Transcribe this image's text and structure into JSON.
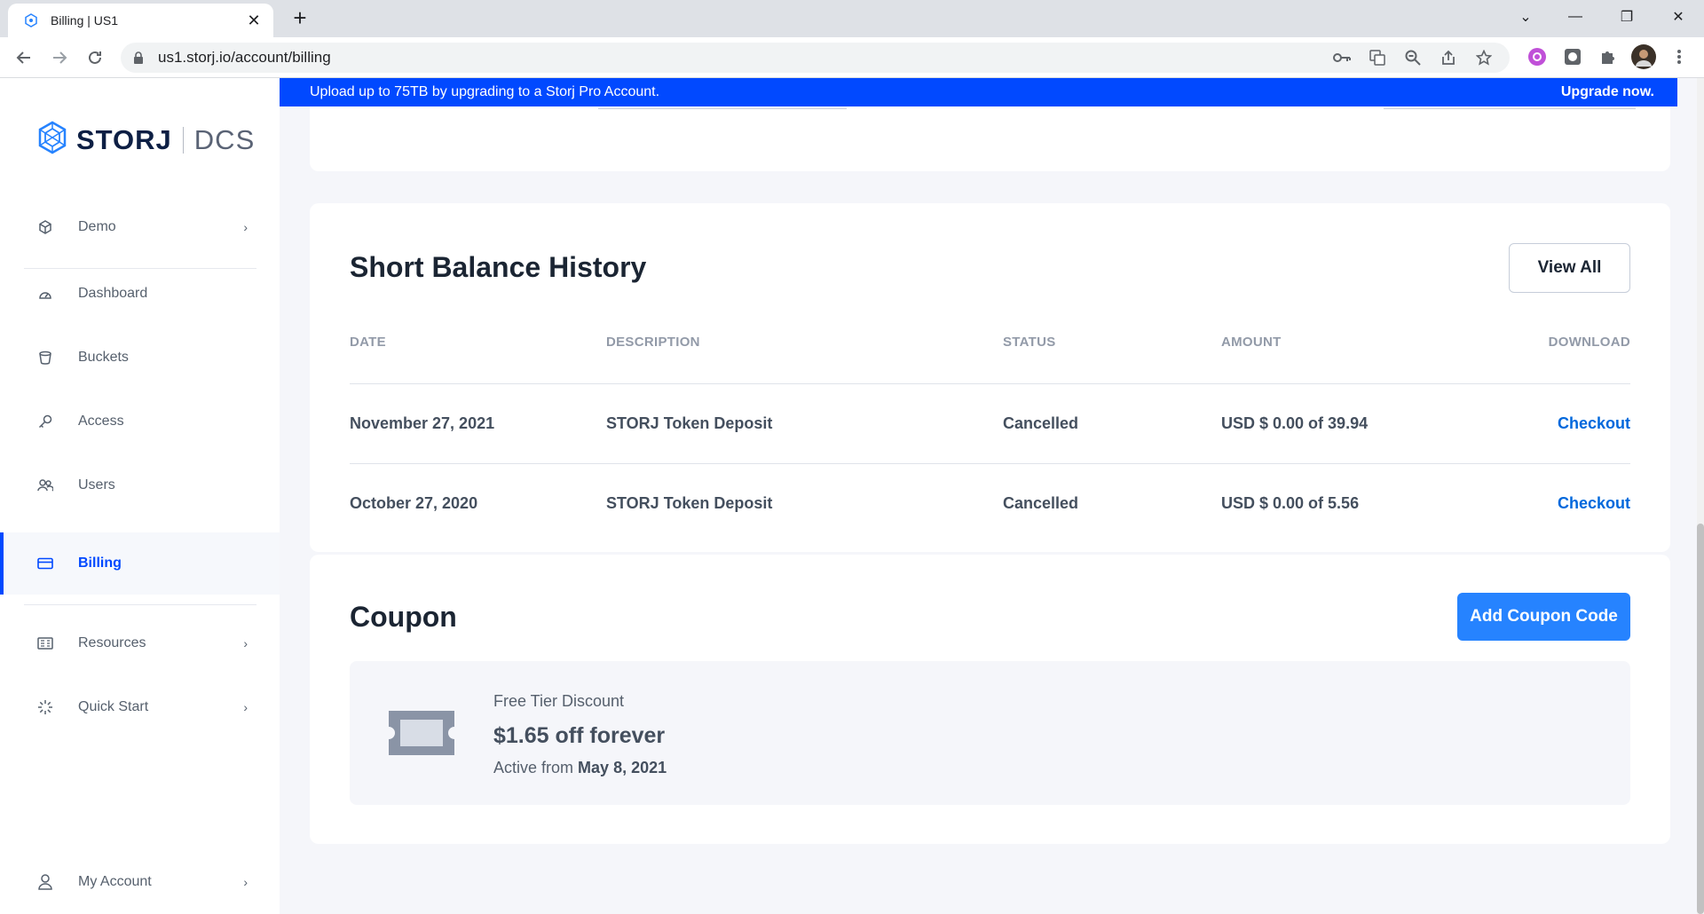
{
  "browser": {
    "tab_title": "Billing | US1",
    "new_tab": "+",
    "close_tab": "✕",
    "url": "us1.storj.io/account/billing",
    "window_controls": [
      "⌄",
      "—",
      "❐",
      "✕"
    ]
  },
  "banner": {
    "message": "Upload up to 75TB by upgrading to a Storj Pro Account.",
    "cta": "Upgrade now."
  },
  "sidebar": {
    "brand": "STORJ",
    "product": "DCS",
    "project": {
      "label": "Demo",
      "icon": "cube-icon"
    },
    "items": [
      {
        "label": "Dashboard",
        "icon": "dashboard-icon"
      },
      {
        "label": "Buckets",
        "icon": "bucket-icon"
      },
      {
        "label": "Access",
        "icon": "key-icon"
      },
      {
        "label": "Users",
        "icon": "users-icon"
      },
      {
        "label": "Billing",
        "icon": "card-icon",
        "active": true
      }
    ],
    "resources": {
      "label": "Resources",
      "icon": "resources-icon"
    },
    "quick_start": {
      "label": "Quick Start",
      "icon": "sparkle-icon"
    },
    "account": {
      "label": "My Account",
      "icon": "user-icon"
    }
  },
  "balance_history": {
    "title": "Short Balance History",
    "view_all": "View All",
    "columns": [
      "DATE",
      "DESCRIPTION",
      "STATUS",
      "AMOUNT",
      "DOWNLOAD"
    ],
    "rows": [
      {
        "date": "November 27, 2021",
        "description": "STORJ Token Deposit",
        "status": "Cancelled",
        "amount": "USD $ 0.00 of 39.94",
        "download": "Checkout"
      },
      {
        "date": "October 27, 2020",
        "description": "STORJ Token Deposit",
        "status": "Cancelled",
        "amount": "USD $ 0.00 of 5.56",
        "download": "Checkout"
      }
    ]
  },
  "coupon": {
    "title": "Coupon",
    "add_button": "Add Coupon Code",
    "name": "Free Tier Discount",
    "value": "$1.65 off forever",
    "active_from_label": "Active from",
    "active_from_date": "May 8, 2021"
  },
  "colors": {
    "brand_blue": "#0149ff",
    "link_blue": "#0068dc",
    "button_blue": "#2683ff"
  }
}
